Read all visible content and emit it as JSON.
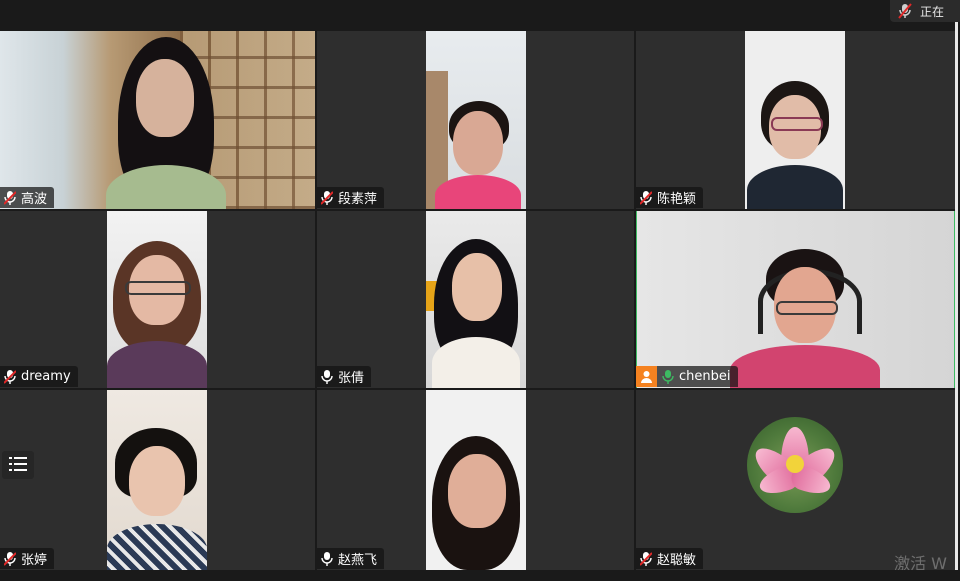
{
  "status": {
    "recording_text": "正在"
  },
  "participants": [
    {
      "name": "高波",
      "mic": "muted",
      "host": false,
      "active": false
    },
    {
      "name": "段素萍",
      "mic": "muted",
      "host": false,
      "active": false
    },
    {
      "name": "陈艳颖",
      "mic": "muted",
      "host": false,
      "active": false
    },
    {
      "name": "dreamy",
      "mic": "muted",
      "host": false,
      "active": false
    },
    {
      "name": "张倩",
      "mic": "on",
      "host": false,
      "active": false
    },
    {
      "name": "chenbei",
      "mic": "on-green",
      "host": true,
      "active": true
    },
    {
      "name": "张婷",
      "mic": "muted",
      "host": false,
      "active": false
    },
    {
      "name": "赵燕飞",
      "mic": "on",
      "host": false,
      "active": false
    },
    {
      "name": "赵聪敏",
      "mic": "muted",
      "host": false,
      "active": false
    }
  ],
  "watermark": "激活 W",
  "colors": {
    "active_border": "#3dbb62",
    "host_badge": "#f58220",
    "muted_red": "#e02828",
    "talk_green": "#3dbb62"
  }
}
